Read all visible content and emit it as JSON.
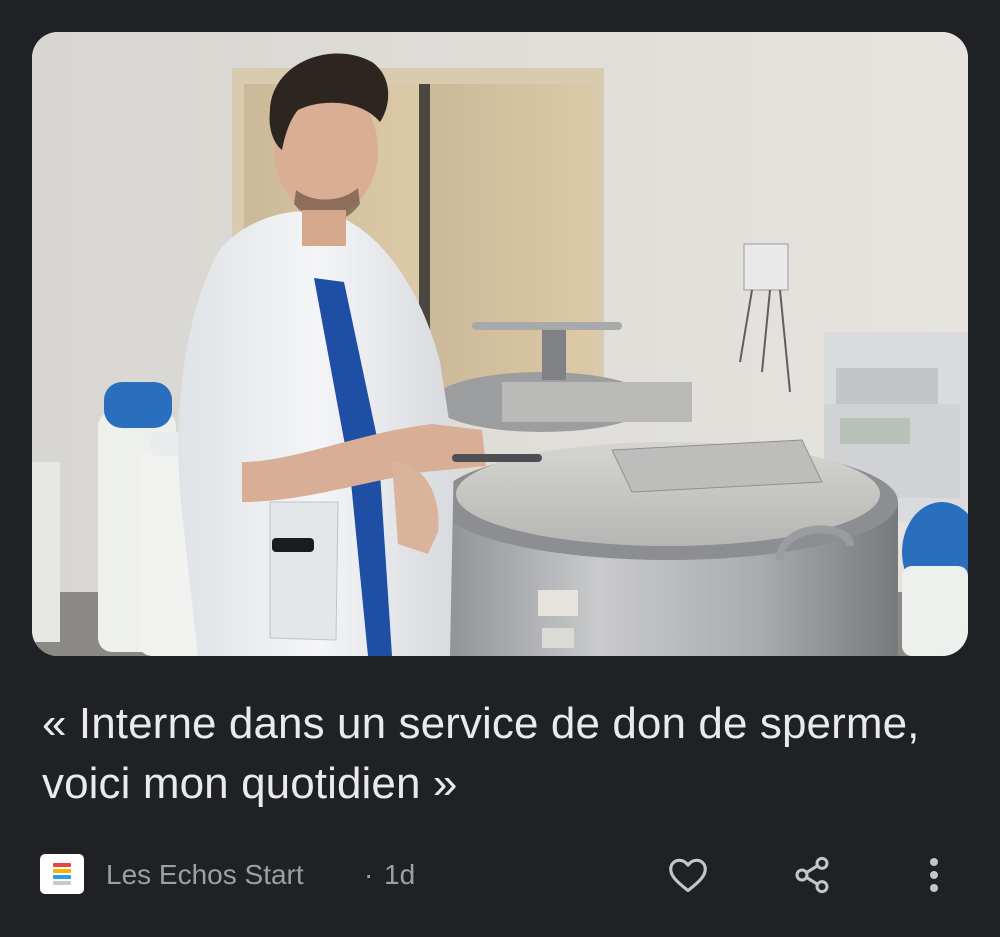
{
  "article": {
    "headline": "« Interne dans un service de don de sperme, voici mon quotidien »",
    "source": "Les Echos Start",
    "separator": "·",
    "age": "1d"
  },
  "image": {
    "alt": "Intern in white coat standing beside cryogenic storage tanks"
  },
  "actions": {
    "like_icon": "heart-icon",
    "share_icon": "share-icon",
    "more_icon": "more-vertical-icon"
  },
  "colors": {
    "background": "#202124",
    "headline_text": "#e8eaed",
    "meta_text": "#9aa0a6",
    "logo_stripes": [
      "#e8453c",
      "#f4b400",
      "#2e9be6",
      "#c9c9c9"
    ]
  }
}
